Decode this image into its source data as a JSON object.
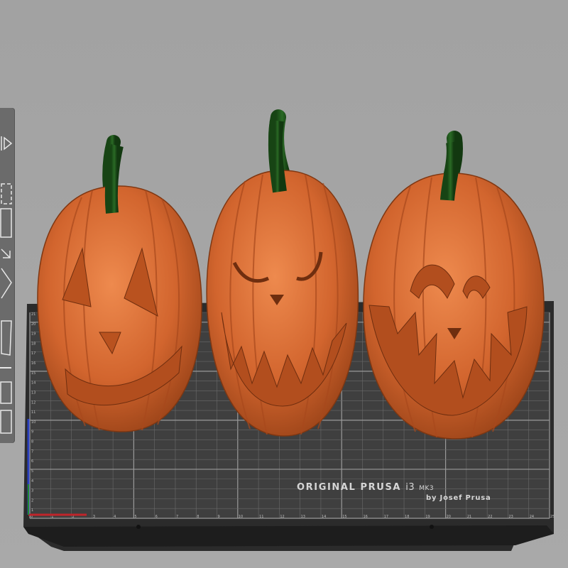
{
  "bed": {
    "brand": "ORIGINAL PRUSA",
    "model": "i3",
    "model_suffix": "MK3",
    "maker": "by Josef Prusa",
    "x_ticks": [
      "0",
      "1",
      "2",
      "3",
      "4",
      "5",
      "6",
      "7",
      "8",
      "9",
      "10",
      "11",
      "12",
      "13",
      "14",
      "15",
      "16",
      "17",
      "18",
      "19",
      "20",
      "21",
      "22",
      "23",
      "24",
      "25"
    ],
    "y_ticks": [
      "1",
      "2",
      "3",
      "4",
      "5",
      "6",
      "7",
      "8",
      "9",
      "10",
      "11",
      "12",
      "13",
      "14",
      "15",
      "16",
      "17",
      "18",
      "19",
      "20",
      "21"
    ]
  },
  "toolbar": {
    "tools": [
      {
        "name": "move-icon"
      },
      {
        "name": "scale-icon"
      },
      {
        "name": "rotate-icon"
      },
      {
        "name": "place-on-face-icon"
      },
      {
        "name": "cut-icon"
      },
      {
        "name": "paint-supports-icon"
      },
      {
        "name": "seam-icon"
      },
      {
        "name": "variable-layer-height-icon"
      }
    ]
  },
  "colors": {
    "background": "#a6a6a6",
    "toolbar": "#6b6b6b",
    "bed_surface": "#3f3f3f",
    "bed_frame": "#2a2a2a",
    "grid_line": "#7c7c7c",
    "pumpkin": "#d2652e",
    "pumpkin_dark": "#8e3a14",
    "stem": "#1f5a1c",
    "axis_x": "#c0242a",
    "axis_y": "#2a3fbf",
    "axis_z": "#1f8a2f"
  },
  "objects": [
    {
      "name": "pumpkin-1"
    },
    {
      "name": "pumpkin-2"
    },
    {
      "name": "pumpkin-3"
    }
  ]
}
